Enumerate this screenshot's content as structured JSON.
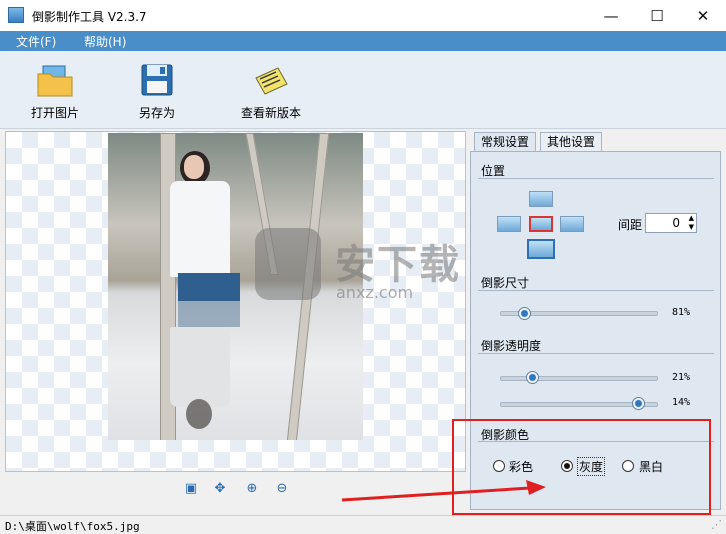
{
  "window": {
    "title": "倒影制作工具 V2.3.7",
    "minimize": "—",
    "maximize": "☐",
    "close": "✕"
  },
  "menu": [
    {
      "label": "文件(F)"
    },
    {
      "label": "帮助(H)"
    }
  ],
  "toolbar": {
    "open": {
      "label": "打开图片",
      "icon": "folder-icon"
    },
    "saveas": {
      "label": "另存为",
      "icon": "floppy-save-icon"
    },
    "update": {
      "label": "查看新版本",
      "icon": "new-version-icon"
    }
  },
  "zoom_tools": [
    "fit-icon",
    "actual-size-icon",
    "zoom-in-icon",
    "zoom-out-icon"
  ],
  "tabs": [
    {
      "label": "常规设置",
      "active": true
    },
    {
      "label": "其他设置",
      "active": false
    }
  ],
  "position": {
    "title": "位置",
    "spacing_label": "间距",
    "spacing_value": "0"
  },
  "size": {
    "title": "倒影尺寸",
    "value_text": "81%",
    "value": 81
  },
  "opacity": {
    "title": "倒影透明度",
    "value1_text": "21%",
    "value1": 21,
    "value2_text": "14%",
    "value2": 14
  },
  "color": {
    "title": "倒影颜色",
    "options": [
      {
        "label": "彩色",
        "checked": false
      },
      {
        "label": "灰度",
        "checked": true
      },
      {
        "label": "黑白",
        "checked": false
      }
    ]
  },
  "watermark": {
    "text": "安下载",
    "sub": "anxz.com"
  },
  "status": {
    "path": "D:\\桌面\\wolf\\fox5.jpg"
  },
  "colors": {
    "menubar": "#4a8ec9",
    "accent": "#2e77c2",
    "annotation": "#e02020"
  }
}
